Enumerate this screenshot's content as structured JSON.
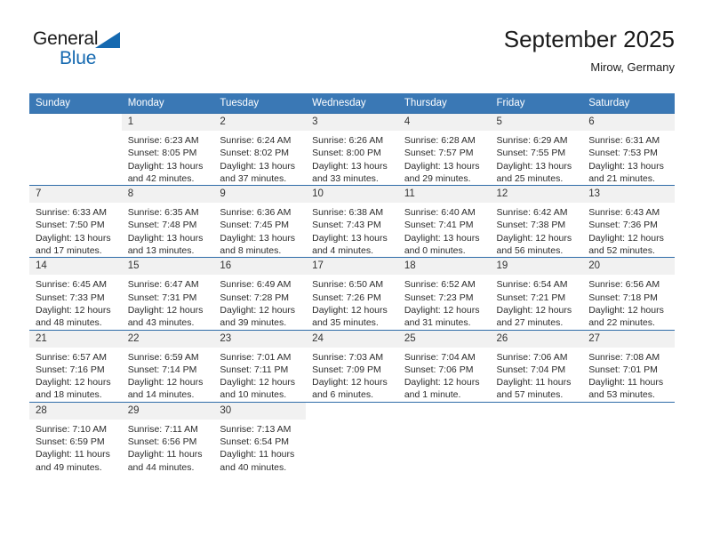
{
  "brand": {
    "word_one": "General",
    "word_two": "Blue",
    "accent_color": "#1569b0"
  },
  "header": {
    "month_title": "September 2025",
    "location": "Mirow, Germany",
    "header_bg": "#3a78b5"
  },
  "weekday_headers": [
    "Sunday",
    "Monday",
    "Tuesday",
    "Wednesday",
    "Thursday",
    "Friday",
    "Saturday"
  ],
  "labels": {
    "sunrise": "Sunrise:",
    "sunset": "Sunset:",
    "daylight": "Daylight:"
  },
  "weeks": [
    [
      {
        "day": "",
        "blank": true
      },
      {
        "day": "1",
        "sunrise": "Sunrise: 6:23 AM",
        "sunset": "Sunset: 8:05 PM",
        "daylight_1": "Daylight: 13 hours",
        "daylight_2": "and 42 minutes."
      },
      {
        "day": "2",
        "sunrise": "Sunrise: 6:24 AM",
        "sunset": "Sunset: 8:02 PM",
        "daylight_1": "Daylight: 13 hours",
        "daylight_2": "and 37 minutes."
      },
      {
        "day": "3",
        "sunrise": "Sunrise: 6:26 AM",
        "sunset": "Sunset: 8:00 PM",
        "daylight_1": "Daylight: 13 hours",
        "daylight_2": "and 33 minutes."
      },
      {
        "day": "4",
        "sunrise": "Sunrise: 6:28 AM",
        "sunset": "Sunset: 7:57 PM",
        "daylight_1": "Daylight: 13 hours",
        "daylight_2": "and 29 minutes."
      },
      {
        "day": "5",
        "sunrise": "Sunrise: 6:29 AM",
        "sunset": "Sunset: 7:55 PM",
        "daylight_1": "Daylight: 13 hours",
        "daylight_2": "and 25 minutes."
      },
      {
        "day": "6",
        "sunrise": "Sunrise: 6:31 AM",
        "sunset": "Sunset: 7:53 PM",
        "daylight_1": "Daylight: 13 hours",
        "daylight_2": "and 21 minutes."
      }
    ],
    [
      {
        "day": "7",
        "sunrise": "Sunrise: 6:33 AM",
        "sunset": "Sunset: 7:50 PM",
        "daylight_1": "Daylight: 13 hours",
        "daylight_2": "and 17 minutes."
      },
      {
        "day": "8",
        "sunrise": "Sunrise: 6:35 AM",
        "sunset": "Sunset: 7:48 PM",
        "daylight_1": "Daylight: 13 hours",
        "daylight_2": "and 13 minutes."
      },
      {
        "day": "9",
        "sunrise": "Sunrise: 6:36 AM",
        "sunset": "Sunset: 7:45 PM",
        "daylight_1": "Daylight: 13 hours",
        "daylight_2": "and 8 minutes."
      },
      {
        "day": "10",
        "sunrise": "Sunrise: 6:38 AM",
        "sunset": "Sunset: 7:43 PM",
        "daylight_1": "Daylight: 13 hours",
        "daylight_2": "and 4 minutes."
      },
      {
        "day": "11",
        "sunrise": "Sunrise: 6:40 AM",
        "sunset": "Sunset: 7:41 PM",
        "daylight_1": "Daylight: 13 hours",
        "daylight_2": "and 0 minutes."
      },
      {
        "day": "12",
        "sunrise": "Sunrise: 6:42 AM",
        "sunset": "Sunset: 7:38 PM",
        "daylight_1": "Daylight: 12 hours",
        "daylight_2": "and 56 minutes."
      },
      {
        "day": "13",
        "sunrise": "Sunrise: 6:43 AM",
        "sunset": "Sunset: 7:36 PM",
        "daylight_1": "Daylight: 12 hours",
        "daylight_2": "and 52 minutes."
      }
    ],
    [
      {
        "day": "14",
        "sunrise": "Sunrise: 6:45 AM",
        "sunset": "Sunset: 7:33 PM",
        "daylight_1": "Daylight: 12 hours",
        "daylight_2": "and 48 minutes."
      },
      {
        "day": "15",
        "sunrise": "Sunrise: 6:47 AM",
        "sunset": "Sunset: 7:31 PM",
        "daylight_1": "Daylight: 12 hours",
        "daylight_2": "and 43 minutes."
      },
      {
        "day": "16",
        "sunrise": "Sunrise: 6:49 AM",
        "sunset": "Sunset: 7:28 PM",
        "daylight_1": "Daylight: 12 hours",
        "daylight_2": "and 39 minutes."
      },
      {
        "day": "17",
        "sunrise": "Sunrise: 6:50 AM",
        "sunset": "Sunset: 7:26 PM",
        "daylight_1": "Daylight: 12 hours",
        "daylight_2": "and 35 minutes."
      },
      {
        "day": "18",
        "sunrise": "Sunrise: 6:52 AM",
        "sunset": "Sunset: 7:23 PM",
        "daylight_1": "Daylight: 12 hours",
        "daylight_2": "and 31 minutes."
      },
      {
        "day": "19",
        "sunrise": "Sunrise: 6:54 AM",
        "sunset": "Sunset: 7:21 PM",
        "daylight_1": "Daylight: 12 hours",
        "daylight_2": "and 27 minutes."
      },
      {
        "day": "20",
        "sunrise": "Sunrise: 6:56 AM",
        "sunset": "Sunset: 7:18 PM",
        "daylight_1": "Daylight: 12 hours",
        "daylight_2": "and 22 minutes."
      }
    ],
    [
      {
        "day": "21",
        "sunrise": "Sunrise: 6:57 AM",
        "sunset": "Sunset: 7:16 PM",
        "daylight_1": "Daylight: 12 hours",
        "daylight_2": "and 18 minutes."
      },
      {
        "day": "22",
        "sunrise": "Sunrise: 6:59 AM",
        "sunset": "Sunset: 7:14 PM",
        "daylight_1": "Daylight: 12 hours",
        "daylight_2": "and 14 minutes."
      },
      {
        "day": "23",
        "sunrise": "Sunrise: 7:01 AM",
        "sunset": "Sunset: 7:11 PM",
        "daylight_1": "Daylight: 12 hours",
        "daylight_2": "and 10 minutes."
      },
      {
        "day": "24",
        "sunrise": "Sunrise: 7:03 AM",
        "sunset": "Sunset: 7:09 PM",
        "daylight_1": "Daylight: 12 hours",
        "daylight_2": "and 6 minutes."
      },
      {
        "day": "25",
        "sunrise": "Sunrise: 7:04 AM",
        "sunset": "Sunset: 7:06 PM",
        "daylight_1": "Daylight: 12 hours",
        "daylight_2": "and 1 minute."
      },
      {
        "day": "26",
        "sunrise": "Sunrise: 7:06 AM",
        "sunset": "Sunset: 7:04 PM",
        "daylight_1": "Daylight: 11 hours",
        "daylight_2": "and 57 minutes."
      },
      {
        "day": "27",
        "sunrise": "Sunrise: 7:08 AM",
        "sunset": "Sunset: 7:01 PM",
        "daylight_1": "Daylight: 11 hours",
        "daylight_2": "and 53 minutes."
      }
    ],
    [
      {
        "day": "28",
        "sunrise": "Sunrise: 7:10 AM",
        "sunset": "Sunset: 6:59 PM",
        "daylight_1": "Daylight: 11 hours",
        "daylight_2": "and 49 minutes."
      },
      {
        "day": "29",
        "sunrise": "Sunrise: 7:11 AM",
        "sunset": "Sunset: 6:56 PM",
        "daylight_1": "Daylight: 11 hours",
        "daylight_2": "and 44 minutes."
      },
      {
        "day": "30",
        "sunrise": "Sunrise: 7:13 AM",
        "sunset": "Sunset: 6:54 PM",
        "daylight_1": "Daylight: 11 hours",
        "daylight_2": "and 40 minutes."
      },
      {
        "day": "",
        "blank": true
      },
      {
        "day": "",
        "blank": true
      },
      {
        "day": "",
        "blank": true
      },
      {
        "day": "",
        "blank": true
      }
    ]
  ]
}
